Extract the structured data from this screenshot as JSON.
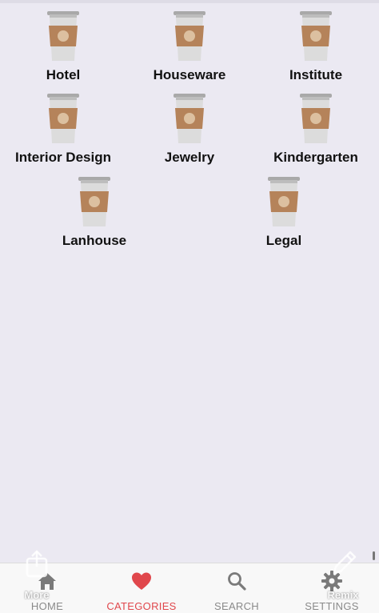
{
  "categories": [
    {
      "label": "Hotel",
      "icon": "coffee-cup-icon"
    },
    {
      "label": "Houseware",
      "icon": "coffee-cup-icon"
    },
    {
      "label": "Institute",
      "icon": "coffee-cup-icon"
    },
    {
      "label": "Interior Design",
      "icon": "coffee-cup-icon"
    },
    {
      "label": "Jewelry",
      "icon": "coffee-cup-icon"
    },
    {
      "label": "Kindergarten",
      "icon": "coffee-cup-icon"
    },
    {
      "label": "Lanhouse",
      "icon": "coffee-cup-icon"
    },
    {
      "label": "Legal",
      "icon": "coffee-cup-icon"
    }
  ],
  "tabbar": {
    "tabs": [
      {
        "label": "HOME",
        "icon": "home-icon",
        "active": false
      },
      {
        "label": "CATEGORIES",
        "icon": "heart-icon",
        "active": true
      },
      {
        "label": "SEARCH",
        "icon": "search-icon",
        "active": false
      },
      {
        "label": "SETTINGS",
        "icon": "gear-icon",
        "active": false
      }
    ]
  },
  "overlay": {
    "more_label": "More",
    "remix_label": "Remix"
  },
  "colors": {
    "background": "#ebe9f2",
    "active_tab": "#e0474c",
    "inactive_tab": "#8a8a8a",
    "cup_sleeve": "#b5835a",
    "cup_lid": "#a7a7a7"
  }
}
